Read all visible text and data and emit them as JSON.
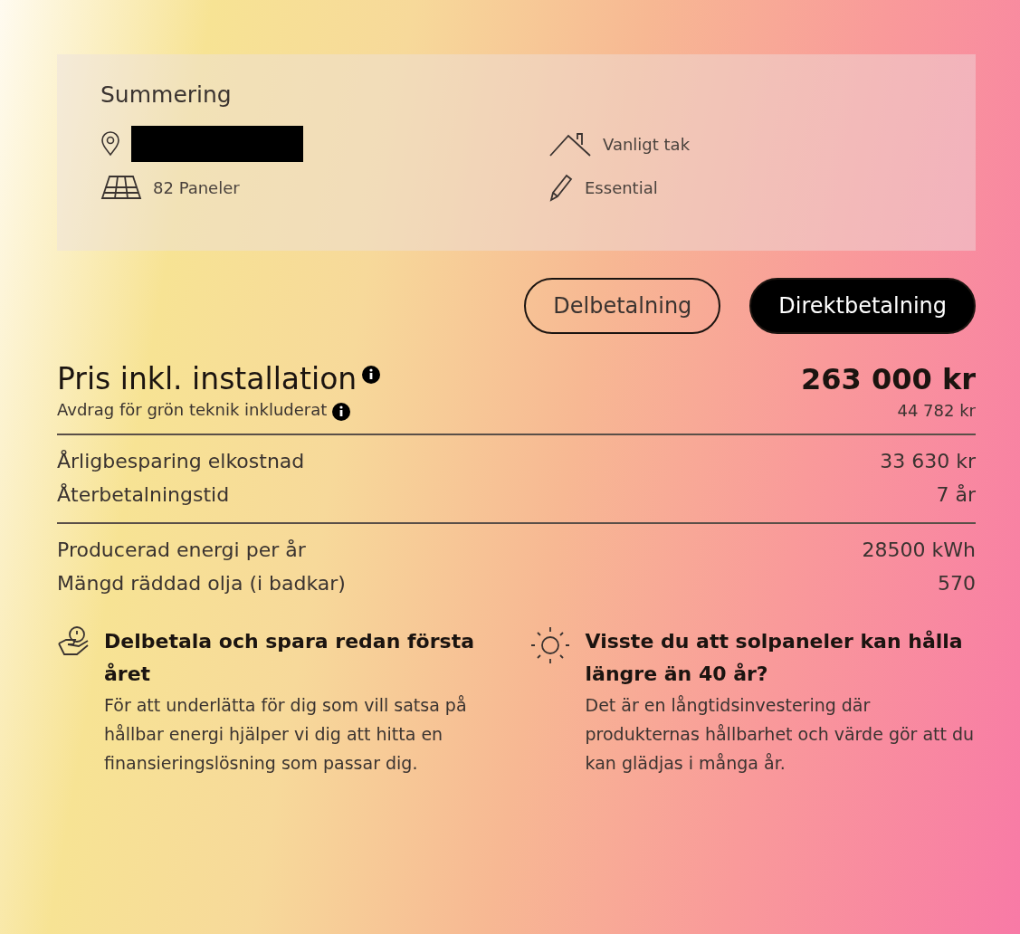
{
  "summary": {
    "title": "Summering",
    "items": [
      {
        "kind": "location",
        "redacted": true
      },
      {
        "kind": "roof",
        "label": "Vanligt tak"
      },
      {
        "kind": "panels",
        "label": "82 Paneler"
      },
      {
        "kind": "pencil",
        "label": "Essential"
      }
    ]
  },
  "payment_options": [
    {
      "label": "Delbetalning",
      "selected": false
    },
    {
      "label": "Direktbetalning",
      "selected": true
    }
  ],
  "price": {
    "label": "Pris inkl. installation",
    "value": "263 000 kr",
    "deduction_label": "Avdrag för grön teknik inkluderat",
    "deduction_value": "44 782 kr"
  },
  "groups": [
    [
      {
        "label": "Årligbesparing elkostnad",
        "value": "33 630 kr"
      },
      {
        "label": "Återbetalningstid",
        "value": "7 år"
      }
    ],
    [
      {
        "label": "Producerad energi per år",
        "value": "28500 kWh"
      },
      {
        "label": "Mängd räddad olja (i badkar)",
        "value": "570"
      }
    ]
  ],
  "tips": [
    {
      "kind": "hand",
      "title": "Delbetala och spara redan första året",
      "body": "För att underlätta för dig som vill satsa på hållbar energi hjälper vi dig att hitta en finansieringslösning som passar dig."
    },
    {
      "kind": "sun",
      "title": "Visste du att solpaneler kan hålla längre än 40 år?",
      "body": "Det är en långtidsinvestering där produkternas hållbarhet och värde gör att du kan glädjas i många år."
    }
  ]
}
